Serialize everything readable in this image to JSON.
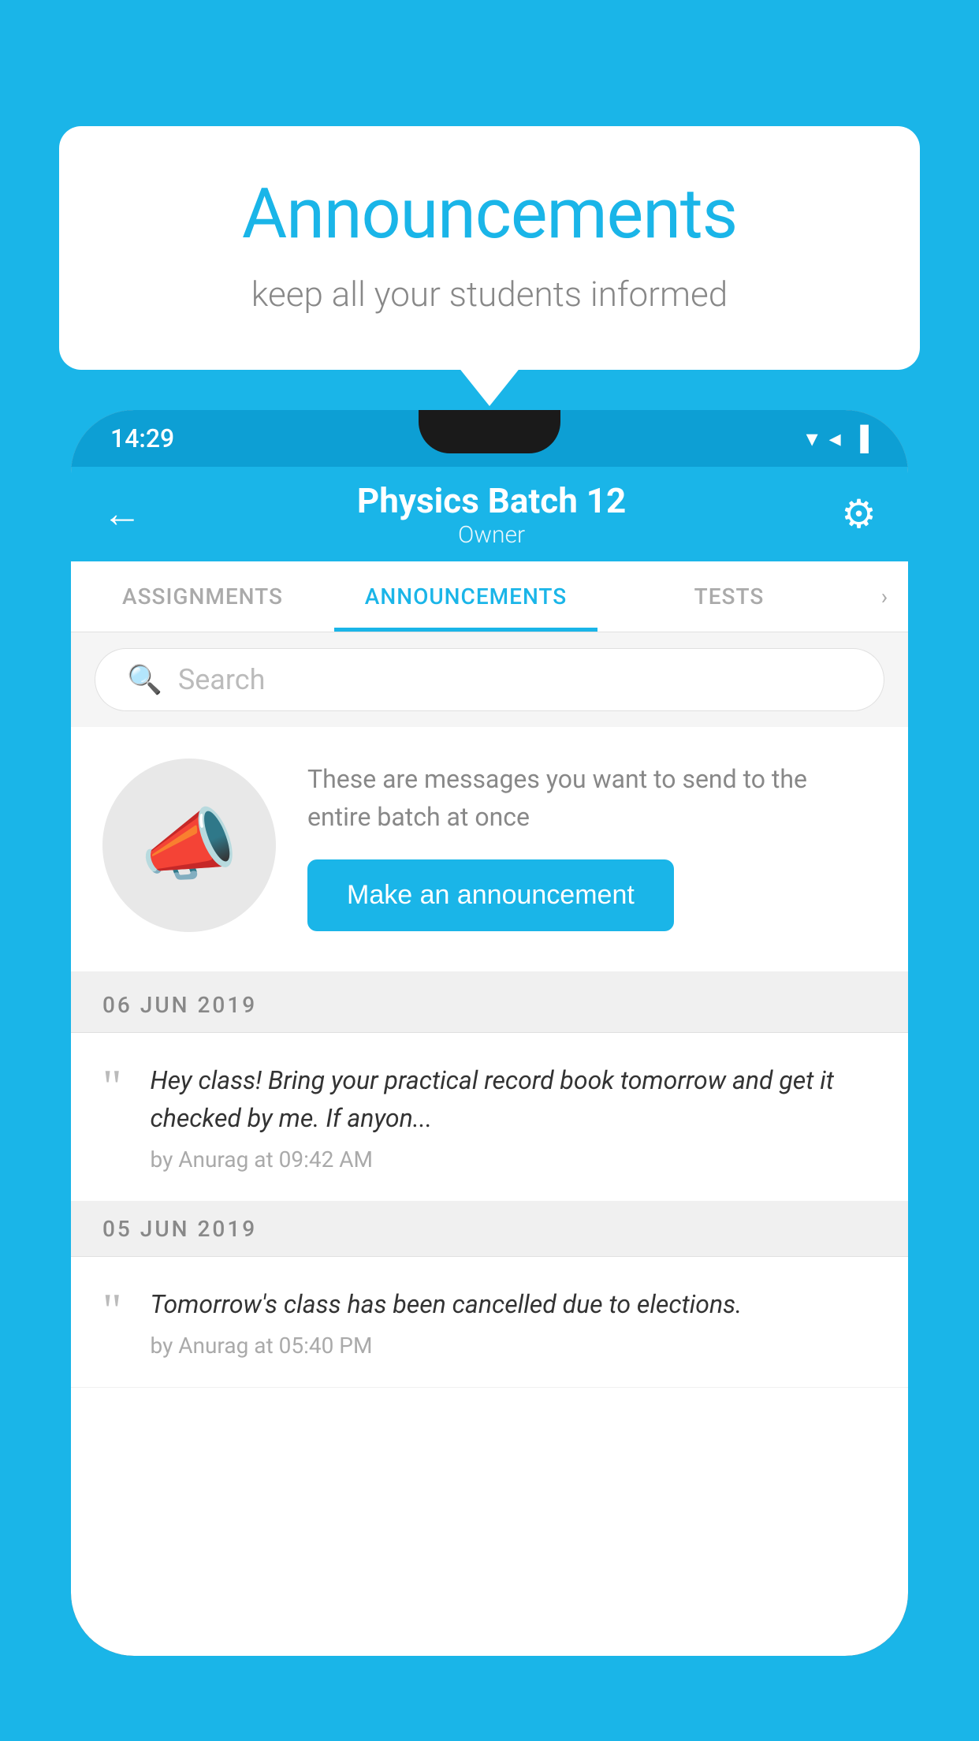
{
  "bubble": {
    "title": "Announcements",
    "subtitle": "keep all your students informed"
  },
  "status_bar": {
    "time": "14:29",
    "wifi": "▼",
    "signal": "▲",
    "battery": "▌"
  },
  "header": {
    "title": "Physics Batch 12",
    "subtitle": "Owner",
    "back_label": "←",
    "gear_label": "⚙"
  },
  "tabs": [
    {
      "label": "ASSIGNMENTS",
      "active": false
    },
    {
      "label": "ANNOUNCEMENTS",
      "active": true
    },
    {
      "label": "TESTS",
      "active": false
    }
  ],
  "search": {
    "placeholder": "Search"
  },
  "promo": {
    "description": "These are messages you want to send to the entire batch at once",
    "button_label": "Make an announcement"
  },
  "announcements": [
    {
      "date": "06  JUN  2019",
      "text": "Hey class! Bring your practical record book tomorrow and get it checked by me. If anyon...",
      "meta": "by Anurag at 09:42 AM"
    },
    {
      "date": "05  JUN  2019",
      "text": "Tomorrow's class has been cancelled due to elections.",
      "meta": "by Anurag at 05:40 PM"
    }
  ]
}
